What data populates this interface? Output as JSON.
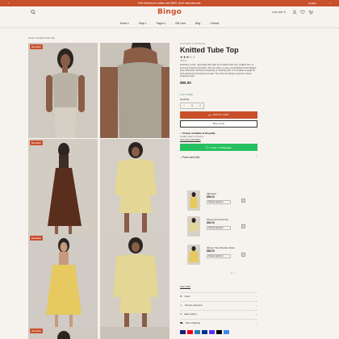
{
  "announcement": {
    "text": "Free Delivery on orders over $200. Don't miss discount.",
    "lang": "English",
    "prev": "‹",
    "next": "›"
  },
  "header": {
    "logo": "Bingo",
    "currency": "India (INR ₹)"
  },
  "nav": [
    "Home ▾",
    "Shop ▾",
    "Pages ▾",
    "Gift Card",
    "Blog",
    "Contact"
  ],
  "breadcrumb": {
    "home": "Home",
    "sep": "/",
    "current": "Knitted Tube Top"
  },
  "gallery": {
    "badge": "Bestseller"
  },
  "product": {
    "vendor": "CLOUDS CLOTHING",
    "title": "Knitted Tube Top",
    "stars": "★★★☆☆",
    "sku": "BINGO",
    "description": "Embrace a chic, minimalist vibe with our Knitted Tube Top. Crafted from a soft and stretchy knit fabric, this top offers a snug, comfortable fit that flatters your silhouette. Perfect for layering or wearing solo, it's versatile enough for both casual and dressed-up looks. The tube top design ensures a sleek, strapless style.",
    "price": "$90.00",
    "in_stock": "● 27 in stock",
    "quantity_label": "Quantity",
    "quantity": "1",
    "minus": "−",
    "plus": "+",
    "add_to_cart": "ADD TO CART",
    "buy_now": "Buy it now",
    "pickup_title": "Pickup available at Bingo/Bj",
    "pickup_sub": "Usually ready in 24 hours",
    "pickup_link": "View store information",
    "whatsapp": "Order on Whatsapp"
  },
  "pairs": {
    "title": "Pairs well with",
    "items": [
      {
        "name": "Silk Scarf",
        "price": "$58.00",
        "select": "Choose options ▾"
      },
      {
        "name": "Woven Knit Scarf Top",
        "price": "$36.00",
        "select": "Choose options ▾"
      },
      {
        "name": "Women Terry Bomber Robe",
        "price": "$88.00",
        "select": "Choose options ▾"
      }
    ],
    "dots": "● ○"
  },
  "size_chart": "Size Chart",
  "features": [
    {
      "label": "Uses",
      "icon": "leaf-icon"
    },
    {
      "label": "Secure payment",
      "icon": "lock-icon"
    },
    {
      "label": "Easy return",
      "icon": "return-icon"
    },
    {
      "label": "Free shipping",
      "icon": "truck-icon"
    }
  ],
  "colors": {
    "accent": "#c8502b",
    "whatsapp": "#25c05f",
    "bg": "#f6f3ee"
  }
}
